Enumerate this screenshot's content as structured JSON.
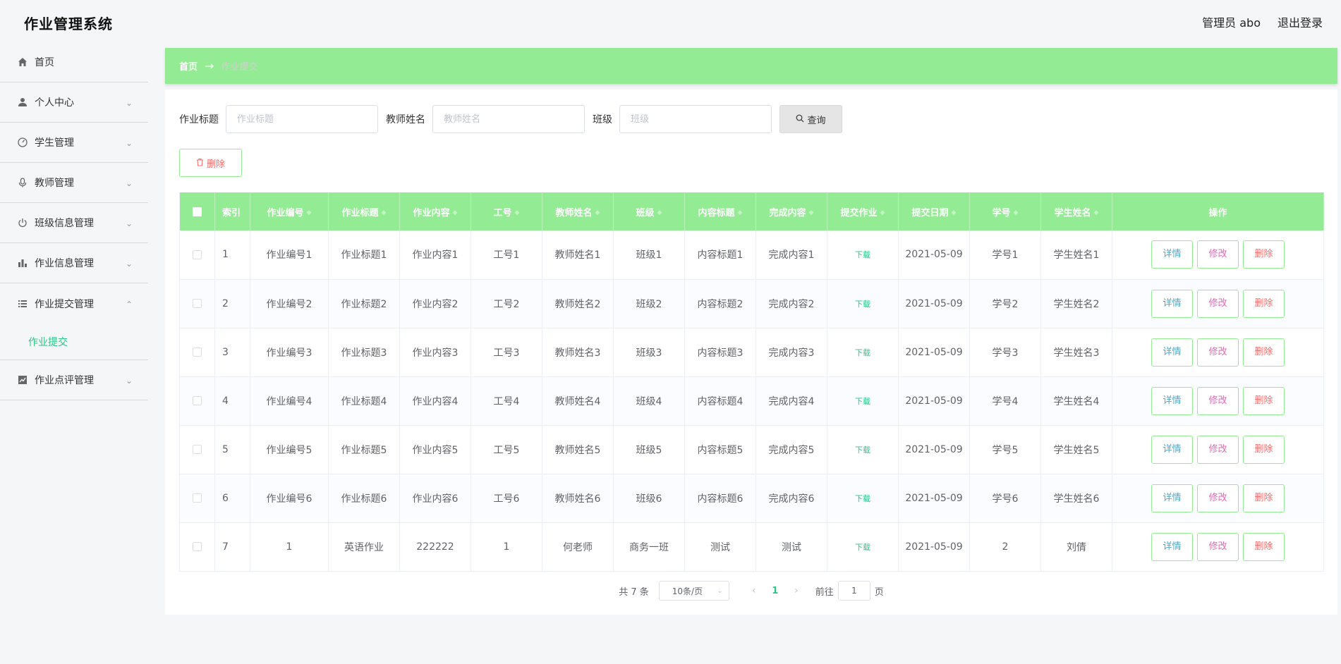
{
  "app": {
    "title": "作业管理系统"
  },
  "header": {
    "user_label": "管理员 abo",
    "logout_label": "退出登录"
  },
  "sidebar": {
    "items": [
      {
        "label": "首页",
        "icon": "home-icon",
        "expandable": false
      },
      {
        "label": "个人中心",
        "icon": "user-icon",
        "expandable": true
      },
      {
        "label": "学生管理",
        "icon": "gauge-icon",
        "expandable": true
      },
      {
        "label": "教师管理",
        "icon": "microphone-icon",
        "expandable": true
      },
      {
        "label": "班级信息管理",
        "icon": "power-icon",
        "expandable": true
      },
      {
        "label": "作业信息管理",
        "icon": "bar-chart-icon",
        "expandable": true
      },
      {
        "label": "作业提交管理",
        "icon": "list-icon",
        "expandable": true,
        "open": true,
        "children": [
          {
            "label": "作业提交"
          }
        ]
      },
      {
        "label": "作业点评管理",
        "icon": "line-chart-icon",
        "expandable": true
      }
    ]
  },
  "breadcrumb": {
    "home": "首页",
    "arrow": "→",
    "current": "作业提交"
  },
  "search": {
    "title_label": "作业标题",
    "title_placeholder": "作业标题",
    "teacher_label": "教师姓名",
    "teacher_placeholder": "教师姓名",
    "class_label": "班级",
    "class_placeholder": "班级",
    "query_label": "查询"
  },
  "toolbar": {
    "delete_label": "删除"
  },
  "table": {
    "columns": [
      "索引",
      "作业编号",
      "作业标题",
      "作业内容",
      "工号",
      "教师姓名",
      "班级",
      "内容标题",
      "完成内容",
      "提交作业",
      "提交日期",
      "学号",
      "学生姓名",
      "操作"
    ],
    "download_label": "下载",
    "actions": {
      "detail": "详情",
      "edit": "修改",
      "delete": "删除"
    },
    "rows": [
      [
        "1",
        "作业编号1",
        "作业标题1",
        "作业内容1",
        "工号1",
        "教师姓名1",
        "班级1",
        "内容标题1",
        "完成内容1",
        "2021-05-09",
        "学号1",
        "学生姓名1"
      ],
      [
        "2",
        "作业编号2",
        "作业标题2",
        "作业内容2",
        "工号2",
        "教师姓名2",
        "班级2",
        "内容标题2",
        "完成内容2",
        "2021-05-09",
        "学号2",
        "学生姓名2"
      ],
      [
        "3",
        "作业编号3",
        "作业标题3",
        "作业内容3",
        "工号3",
        "教师姓名3",
        "班级3",
        "内容标题3",
        "完成内容3",
        "2021-05-09",
        "学号3",
        "学生姓名3"
      ],
      [
        "4",
        "作业编号4",
        "作业标题4",
        "作业内容4",
        "工号4",
        "教师姓名4",
        "班级4",
        "内容标题4",
        "完成内容4",
        "2021-05-09",
        "学号4",
        "学生姓名4"
      ],
      [
        "5",
        "作业编号5",
        "作业标题5",
        "作业内容5",
        "工号5",
        "教师姓名5",
        "班级5",
        "内容标题5",
        "完成内容5",
        "2021-05-09",
        "学号5",
        "学生姓名5"
      ],
      [
        "6",
        "作业编号6",
        "作业标题6",
        "作业内容6",
        "工号6",
        "教师姓名6",
        "班级6",
        "内容标题6",
        "完成内容6",
        "2021-05-09",
        "学号6",
        "学生姓名6"
      ],
      [
        "7",
        "1",
        "英语作业",
        "222222",
        "1",
        "何老师",
        "商务一班",
        "测试",
        "测试",
        "2021-05-09",
        "2",
        "刘倩"
      ]
    ]
  },
  "pagination": {
    "total_text": "共 7 条",
    "page_size": "10条/页",
    "current_page": "1",
    "jump_prefix": "前往",
    "jump_value": "1",
    "jump_suffix": "页"
  },
  "colors": {
    "accent": "#93ec93",
    "link": "#2ec486",
    "danger": "#f36c6c"
  }
}
